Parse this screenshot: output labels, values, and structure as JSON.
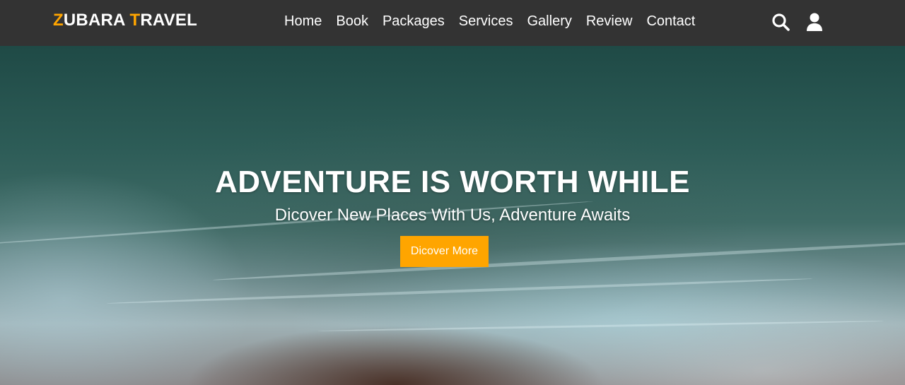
{
  "brand": {
    "first_letter": "Z",
    "first_rest": "UBARA ",
    "second_letter": "T",
    "second_rest": "RAVEL",
    "accent_color": "#ffa500"
  },
  "nav": {
    "links": [
      "Home",
      "Book",
      "Packages",
      "Services",
      "Gallery",
      "Review",
      "Contact"
    ],
    "icons": [
      "search-icon",
      "user-icon"
    ]
  },
  "hero": {
    "title": "ADVENTURE IS WORTH WHILE",
    "subtitle": "Dicover New Places With Us, Adventure Awaits",
    "button_label": "Dicover More",
    "button_color": "#ffa500",
    "background": "aerial ocean waves"
  },
  "colors": {
    "navbar": "#333333",
    "text": "#ffffff"
  }
}
